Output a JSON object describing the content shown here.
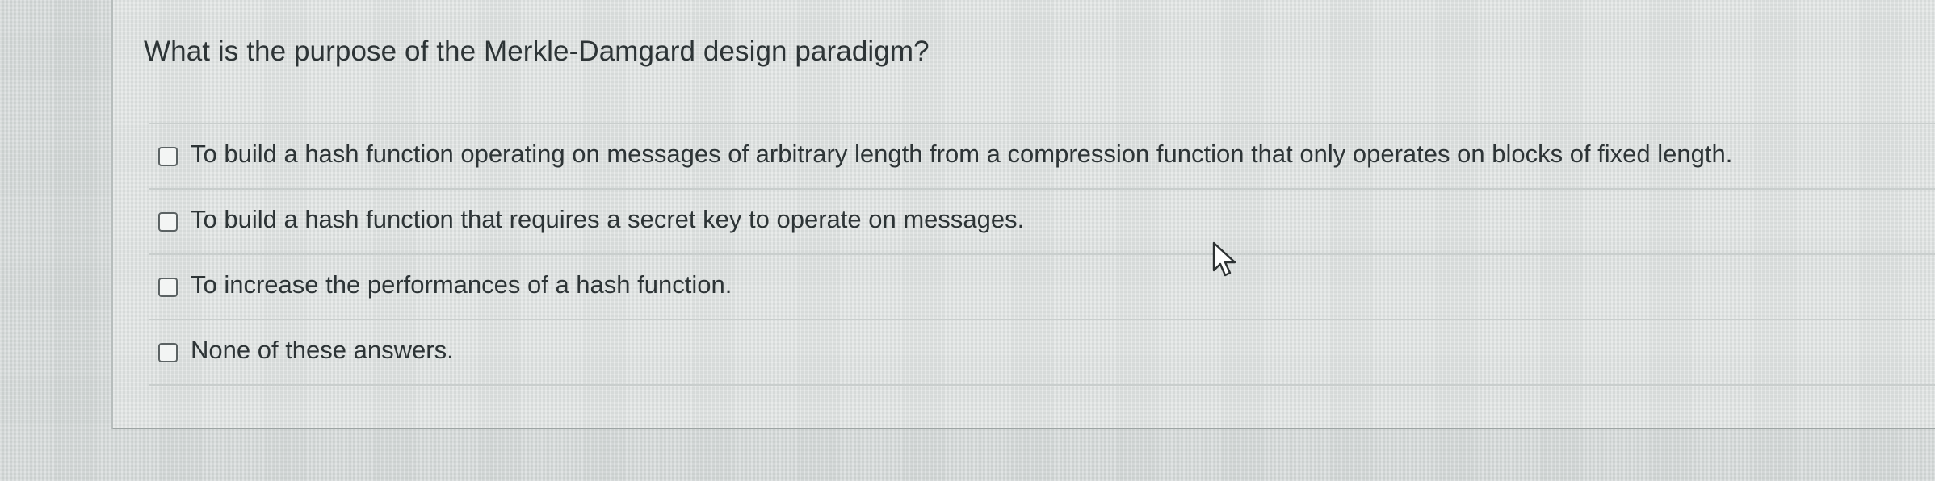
{
  "question": {
    "text": "What is the purpose of the Merkle-Damgard design paradigm?"
  },
  "answers": [
    {
      "label": "To build a hash function operating on messages of arbitrary length from a compression function that only operates on blocks of fixed length.",
      "checked": false
    },
    {
      "label": "To build a hash function that requires a secret key to operate on messages.",
      "checked": false
    },
    {
      "label": "To increase the performances of a hash function.",
      "checked": false
    },
    {
      "label": "None of these answers.",
      "checked": false
    }
  ],
  "cursor": {
    "icon": "mouse-pointer-icon"
  }
}
